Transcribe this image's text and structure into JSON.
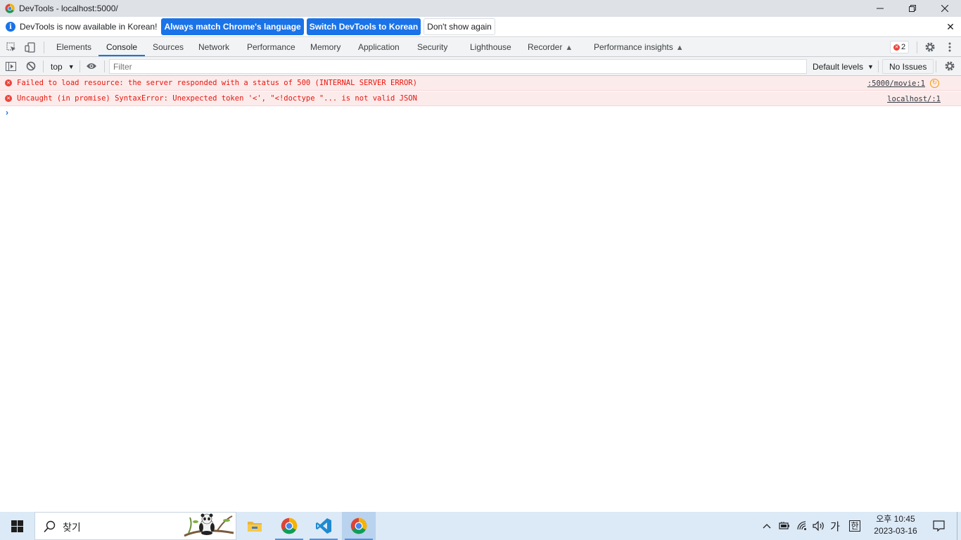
{
  "window": {
    "title": "DevTools - localhost:5000/",
    "controls": [
      "minimize-icon",
      "restore-icon",
      "close-icon"
    ]
  },
  "infobar": {
    "message": "DevTools is now available in Korean!",
    "btn_match": "Always match Chrome's language",
    "btn_switch": "Switch DevTools to Korean",
    "btn_dismiss": "Don't show again",
    "close": "✕"
  },
  "tabs": {
    "items": [
      "Elements",
      "Console",
      "Sources",
      "Network",
      "Performance",
      "Memory",
      "Application",
      "Security",
      "Lighthouse",
      "Recorder",
      "Performance insights"
    ],
    "active": "Console",
    "error_count": "2"
  },
  "console_toolbar": {
    "context": "top",
    "filter_placeholder": "Filter",
    "levels": "Default levels",
    "issues": "No Issues"
  },
  "messages": [
    {
      "level": "error",
      "text": "Failed to load resource: the server responded with a status of 500 (INTERNAL SERVER ERROR)",
      "source": ":5000/movie:1"
    },
    {
      "level": "error",
      "text": "Uncaught (in promise) SyntaxError: Unexpected token '<', \"<!doctype \"... is not valid JSON",
      "source": "localhost/:1"
    }
  ],
  "prompt": "›",
  "taskbar": {
    "search_placeholder": "찾기",
    "ime_lang": "가",
    "ime_mode": "한",
    "time": "오후 10:45",
    "date": "2023-03-16"
  },
  "colors": {
    "accent": "#1a73e8",
    "error_text": "#e8150c",
    "error_bg": "#fcebeb",
    "toolbar_bg": "#f1f3f4",
    "taskbar_bg": "#dce9f6"
  }
}
